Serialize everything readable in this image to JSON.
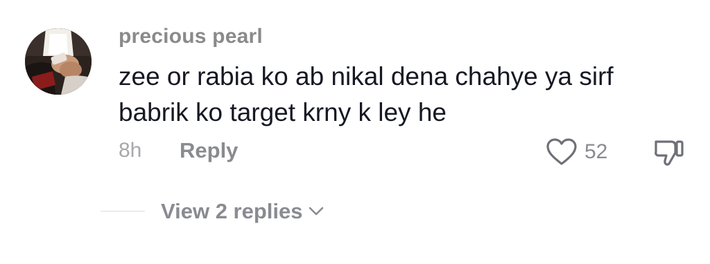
{
  "comment": {
    "username": "precious pearl",
    "text_line1": "zee or rabia ko ab nikal dena chahye ya sirf",
    "text_line2": "babrik ko target krny k ley he",
    "timestamp": "8h",
    "reply_label": "Reply",
    "like_count": "52",
    "view_replies_label": "View 2 replies"
  },
  "icons": {
    "like": "heart-outline-icon",
    "dislike": "thumbs-down-outline-icon",
    "expand": "chevron-down-icon"
  },
  "colors": {
    "username": "#8a8a8a",
    "body_text": "#161823",
    "meta_text": "#8a8b91",
    "icon_stroke": "#6f7077"
  }
}
